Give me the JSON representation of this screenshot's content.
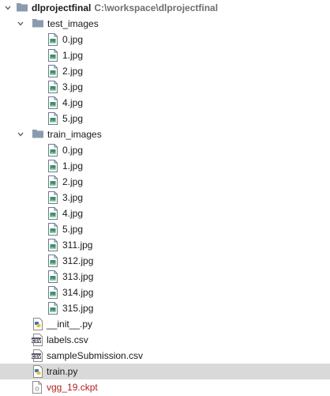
{
  "tree": {
    "root": {
      "name": "dlprojectfinal",
      "path": "C:\\workspace\\dlprojectfinal"
    },
    "test_folder": {
      "name": "test_images",
      "files": [
        "0.jpg",
        "1.jpg",
        "2.jpg",
        "3.jpg",
        "4.jpg",
        "5.jpg"
      ]
    },
    "train_folder": {
      "name": "train_images",
      "files": [
        "0.jpg",
        "1.jpg",
        "2.jpg",
        "3.jpg",
        "4.jpg",
        "5.jpg",
        "311.jpg",
        "312.jpg",
        "313.jpg",
        "314.jpg",
        "315.jpg"
      ]
    },
    "root_files": [
      {
        "name": "__init__.py",
        "icon": "python-file-icon"
      },
      {
        "name": "labels.csv",
        "icon": "csv-file-icon"
      },
      {
        "name": "sampleSubmission.csv",
        "icon": "csv-file-icon"
      },
      {
        "name": "train.py",
        "icon": "python-file-icon",
        "selected": true
      },
      {
        "name": "vgg_19.ckpt",
        "icon": "unknown-file-icon",
        "color": "#b22222"
      }
    ]
  }
}
